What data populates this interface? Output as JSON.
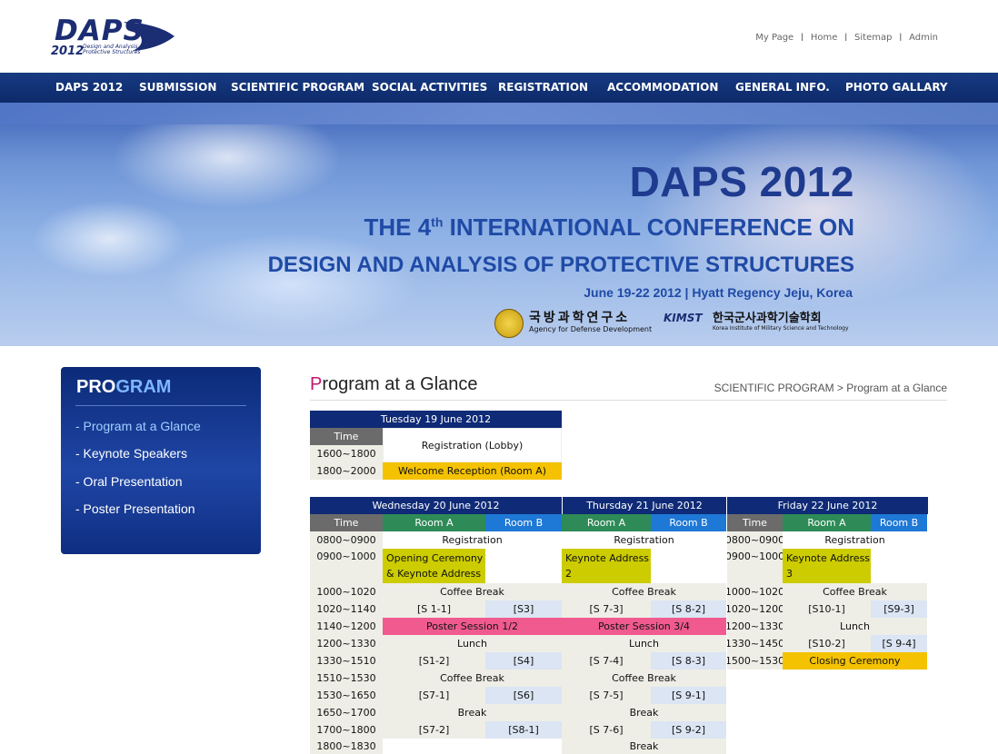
{
  "header": {
    "logo_text": "DAPS",
    "logo_year": "2012",
    "logo_subtitle": "Design and Analysis of Protective Structures",
    "util_links": [
      "My Page",
      "Home",
      "Sitemap",
      "Admin"
    ]
  },
  "nav": [
    "DAPS 2012",
    "SUBMISSION",
    "SCIENTIFIC PROGRAM",
    "SOCIAL ACTIVITIES",
    "REGISTRATION",
    "ACCOMMODATION",
    "GENERAL INFO.",
    "PHOTO GALLARY"
  ],
  "banner": {
    "title": "DAPS 2012",
    "line2_pre": "THE 4",
    "line2_sup": "th",
    "line2_post": " INTERNATIONAL CONFERENCE ON",
    "line3": "DESIGN AND ANALYSIS OF PROTECTIVE STRUCTURES",
    "date": "June 19-22 2012 |  Hyatt Regency Jeju, Korea",
    "add_kr": "국방과학연구소",
    "add_en": "Agency for Defense Development",
    "kimst_badge": "KIMST",
    "kimst_kr": "한국군사과학기술학회",
    "kimst_en": "Korea Institute of Military Science and Technology"
  },
  "sidebar": {
    "title_a": "PRO",
    "title_b": "GRAM",
    "items": [
      "- Program at a Glance",
      "- Keynote Speakers",
      "- Oral Presentation",
      "- Poster Presentation"
    ]
  },
  "page": {
    "title_first": "P",
    "title_rest": "rogram at a Glance",
    "breadcrumb": "SCIENTIFIC PROGRAM > Program at a Glance"
  },
  "schedule": {
    "tue_header": "Tuesday 19 June 2012",
    "time": "Time",
    "tue_t1": "1600~1800",
    "tue_reg": "Registration (Lobby)",
    "tue_t2": "1800~2000",
    "tue_welcome": "Welcome Reception (Room A)",
    "wed_header": "Wednesday 20 June 2012",
    "thu_header": "Thursday 21 June 2012",
    "fri_header": "Friday 22 June 2012",
    "room_a": "Room A",
    "room_b": "Room B",
    "wed_times": [
      "0800~0900",
      "0900~1000",
      "1000~1020",
      "1020~1140",
      "1140~1200",
      "1200~1330",
      "1330~1510",
      "1510~1530",
      "1530~1650",
      "1650~1700",
      "1700~1800",
      "1800~1830"
    ],
    "fri_times": [
      "0800~0900",
      "0900~1000",
      "1000~1020",
      "1020~1200",
      "1200~1330",
      "1330~1450",
      "1500~1530"
    ],
    "registration": "Registration",
    "opening": "Opening Ceremony\n& Keynote Address",
    "keynote2": "Keynote Address\n2",
    "keynote3": "Keynote Address\n3",
    "coffee": "Coffee Break",
    "lunch": "Lunch",
    "break": "Break",
    "poster12": "Poster Session 1/2",
    "poster34": "Poster Session 3/4",
    "closing": "Closing Ceremony",
    "wed_a": [
      "[S 1-1]",
      "[S1-2]",
      "[S7-1]",
      "[S7-2]"
    ],
    "wed_b": [
      "[S3]",
      "[S4]",
      "[S6]",
      "[S8-1]"
    ],
    "thu_a": [
      "[S 7-3]",
      "[S 7-4]",
      "[S 7-5]",
      "[S 7-6]"
    ],
    "thu_b": [
      "[S 8-2]",
      "[S 8-3]",
      "[S 9-1]",
      "[S 9-2]"
    ],
    "fri_a": [
      "[S10-1]",
      "[S10-2]"
    ],
    "fri_b": [
      "[S9-3]",
      "[S 9-4]"
    ]
  },
  "colors": {
    "nav_bg": "#0f2a6e",
    "header_bg": "#0f2a76",
    "room_a": "#2e8b57",
    "room_b": "#1e78d6",
    "welcome": "#f4c200",
    "keynote": "#cccc00",
    "poster": "#f05a8f",
    "session_b": "#dbe5f3",
    "row_bg": "#eeeee6"
  }
}
